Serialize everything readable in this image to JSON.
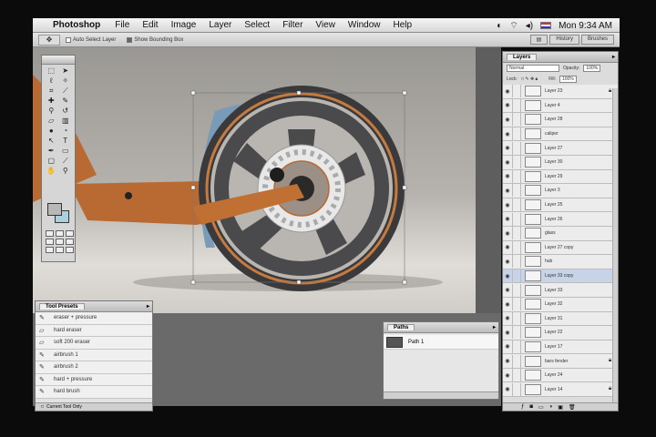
{
  "menubar": {
    "app": "Photoshop",
    "items": [
      "File",
      "Edit",
      "Image",
      "Layer",
      "Select",
      "Filter",
      "View",
      "Window",
      "Help"
    ],
    "clock": "Mon 9:34 AM"
  },
  "options": {
    "auto_select": "Auto Select Layer",
    "bounding_box": "Show Bounding Box",
    "well_history": "History",
    "well_brushes": "Brushes"
  },
  "presets": {
    "title": "Tool Presets",
    "items": [
      "eraser + pressure",
      "hard eraser",
      "soft 200 eraser",
      "airbrush 1",
      "airbrush 2",
      "hard + pressure",
      "hard brush"
    ],
    "footer": "Current Tool Only"
  },
  "paths": {
    "title": "Paths",
    "items": [
      "Path 1"
    ]
  },
  "layers": {
    "title": "Layers",
    "blend": "Normal",
    "opacity_label": "Opacity:",
    "opacity": "100%",
    "lock_label": "Lock:",
    "fill_label": "Fill:",
    "fill": "100%",
    "rows": [
      {
        "name": "Layer 23",
        "locked": true
      },
      {
        "name": "Layer 4",
        "locked": false
      },
      {
        "name": "Layer 28",
        "locked": false
      },
      {
        "name": "caliper",
        "locked": false
      },
      {
        "name": "Layer 27",
        "locked": false
      },
      {
        "name": "Layer 30",
        "locked": false
      },
      {
        "name": "Layer 29",
        "locked": false
      },
      {
        "name": "Layer 3",
        "locked": false
      },
      {
        "name": "Layer 25",
        "locked": false
      },
      {
        "name": "Layer 26",
        "locked": false
      },
      {
        "name": "glass",
        "locked": false
      },
      {
        "name": "Layer 27 copy",
        "locked": false
      },
      {
        "name": "hub",
        "locked": false
      },
      {
        "name": "Layer 33 copy",
        "locked": false,
        "selected": true
      },
      {
        "name": "Layer 33",
        "locked": false
      },
      {
        "name": "Layer 32",
        "locked": false
      },
      {
        "name": "Layer 31",
        "locked": false
      },
      {
        "name": "Layer 22",
        "locked": false
      },
      {
        "name": "Layer 17",
        "locked": false
      },
      {
        "name": "bars fender",
        "locked": true
      },
      {
        "name": "Layer 24",
        "locked": false
      },
      {
        "name": "Layer 14",
        "locked": true
      }
    ]
  },
  "colors": {
    "accent_orange": "#b86a32",
    "tire": "#3a3a3c",
    "rim_orange": "#c77a3e",
    "fender_blue": "#7a9bb8",
    "selection": "#c7d4e8"
  }
}
